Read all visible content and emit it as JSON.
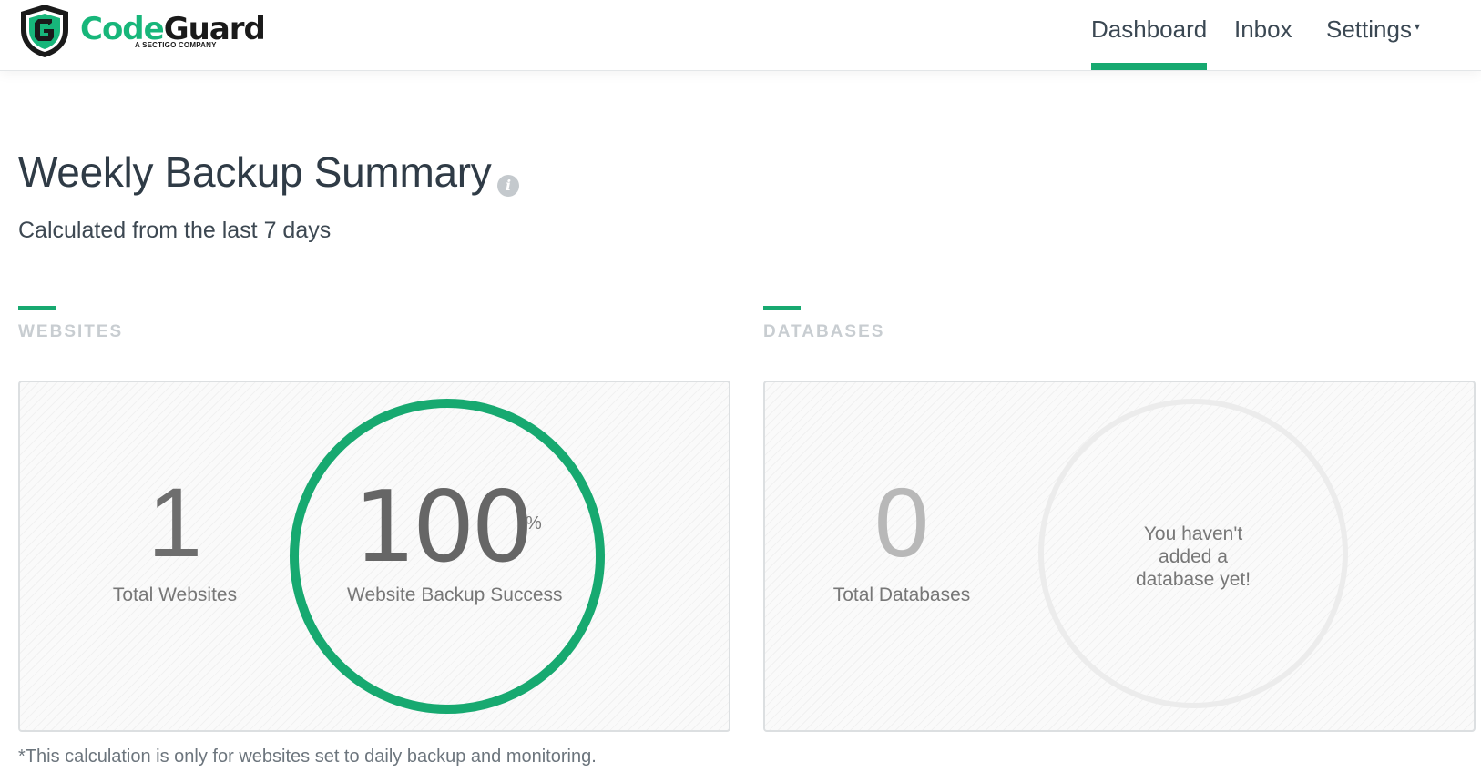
{
  "brand": {
    "name_part1": "Code",
    "name_part2": "Guard",
    "tagline": "A SECTIGO COMPANY",
    "accent_color": "#17a970"
  },
  "nav": {
    "items": [
      {
        "label": "Dashboard",
        "active": true
      },
      {
        "label": "Inbox",
        "active": false
      },
      {
        "label": "Settings",
        "active": false,
        "caret": "▾"
      }
    ]
  },
  "header": {
    "title": "Weekly Backup Summary",
    "info_icon": "i",
    "subtitle": "Calculated from the last 7 days"
  },
  "websites": {
    "section_label": "WEBSITES",
    "total_value": "1",
    "total_label": "Total Websites",
    "success_value": "100",
    "success_unit": "%",
    "success_label": "Website Backup Success",
    "success_fraction": 1.0
  },
  "databases": {
    "section_label": "DATABASES",
    "total_value": "0",
    "total_label": "Total Databases",
    "empty_message": "You haven't added a database yet!"
  },
  "footnote": "*This calculation is only for websites set to daily backup and monitoring."
}
